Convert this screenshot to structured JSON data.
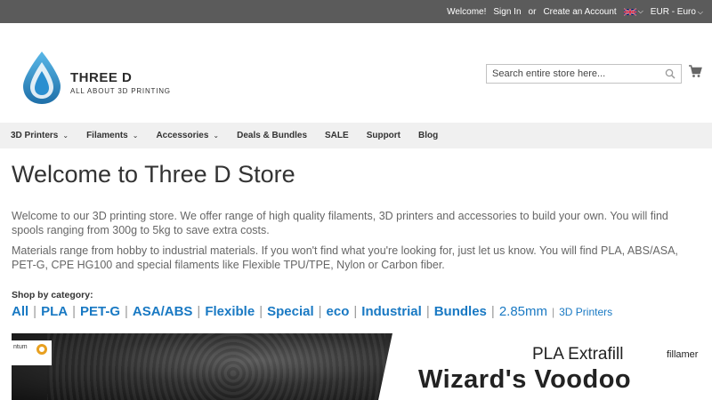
{
  "topbar": {
    "welcome": "Welcome!",
    "sign_in": "Sign In",
    "or": "or",
    "create_account": "Create an Account",
    "currency": "EUR - Euro"
  },
  "header": {
    "brand": "THREE D",
    "tagline": "ALL ABOUT 3D PRINTING",
    "search_placeholder": "Search entire store here...",
    "icons": [
      "search-icon",
      "cart-icon",
      "uk-flag-icon"
    ]
  },
  "nav": {
    "items": [
      {
        "label": "3D Printers",
        "dropdown": true
      },
      {
        "label": "Filaments",
        "dropdown": true
      },
      {
        "label": "Accessories",
        "dropdown": true
      },
      {
        "label": "Deals & Bundles",
        "dropdown": false
      },
      {
        "label": "SALE",
        "dropdown": false
      },
      {
        "label": "Support",
        "dropdown": false
      },
      {
        "label": "Blog",
        "dropdown": false
      }
    ]
  },
  "main": {
    "title": "Welcome to Three D Store",
    "para1": "Welcome to our 3D printing store. We offer range of high quality filaments, 3D printers and accessories to build your own. You will find spools ranging from 300g to 5kg to save extra costs.",
    "para2": "Materials range from hobby to industrial materials. If you won't find what you're looking for, just let us know. You will find PLA, ABS/ASA, PET-G, CPE HG100 and special filaments like Flexible TPU/TPE, Nylon or Carbon fiber.",
    "shop_label": "Shop by category:",
    "categories": [
      "All",
      "PLA",
      "PET-G",
      "ASA/ABS",
      "Flexible",
      "Special",
      "eco",
      "Industrial",
      "Bundles"
    ],
    "cat_size": "2.85mm",
    "cat_printers": "3D Printers"
  },
  "banner": {
    "corner_text": "ntum",
    "line1": "PLA Extrafill",
    "line2": "Wizard's Voodoo",
    "brand": "fillamer"
  },
  "colors": {
    "topbar": "#5b5b5b",
    "nav_bg": "#f0f0f0",
    "link": "#1979c3",
    "logo_blue": "#2a8fd0"
  }
}
